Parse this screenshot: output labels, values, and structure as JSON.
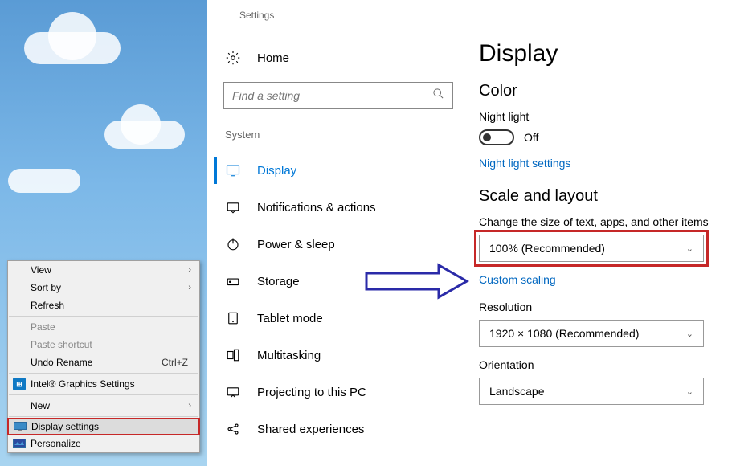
{
  "context_menu": {
    "view": "View",
    "sort_by": "Sort by",
    "refresh": "Refresh",
    "paste": "Paste",
    "paste_shortcut": "Paste shortcut",
    "undo_rename": "Undo Rename",
    "undo_shortcut": "Ctrl+Z",
    "intel": "Intel® Graphics Settings",
    "new": "New",
    "display_settings": "Display settings",
    "personalize": "Personalize"
  },
  "settings": {
    "app_label": "Settings",
    "home": "Home",
    "search_placeholder": "Find a setting",
    "section": "System",
    "nav": {
      "display": "Display",
      "notifications": "Notifications & actions",
      "power": "Power & sleep",
      "storage": "Storage",
      "tablet": "Tablet mode",
      "multitasking": "Multitasking",
      "projecting": "Projecting to this PC",
      "shared": "Shared experiences"
    }
  },
  "display": {
    "title": "Display",
    "color_heading": "Color",
    "night_light_label": "Night light",
    "night_light_state": "Off",
    "night_light_link": "Night light settings",
    "scale_heading": "Scale and layout",
    "scale_label": "Change the size of text, apps, and other items",
    "scale_value": "100% (Recommended)",
    "custom_scaling": "Custom scaling",
    "resolution_label": "Resolution",
    "resolution_value": "1920 × 1080 (Recommended)",
    "orientation_label": "Orientation",
    "orientation_value": "Landscape"
  }
}
